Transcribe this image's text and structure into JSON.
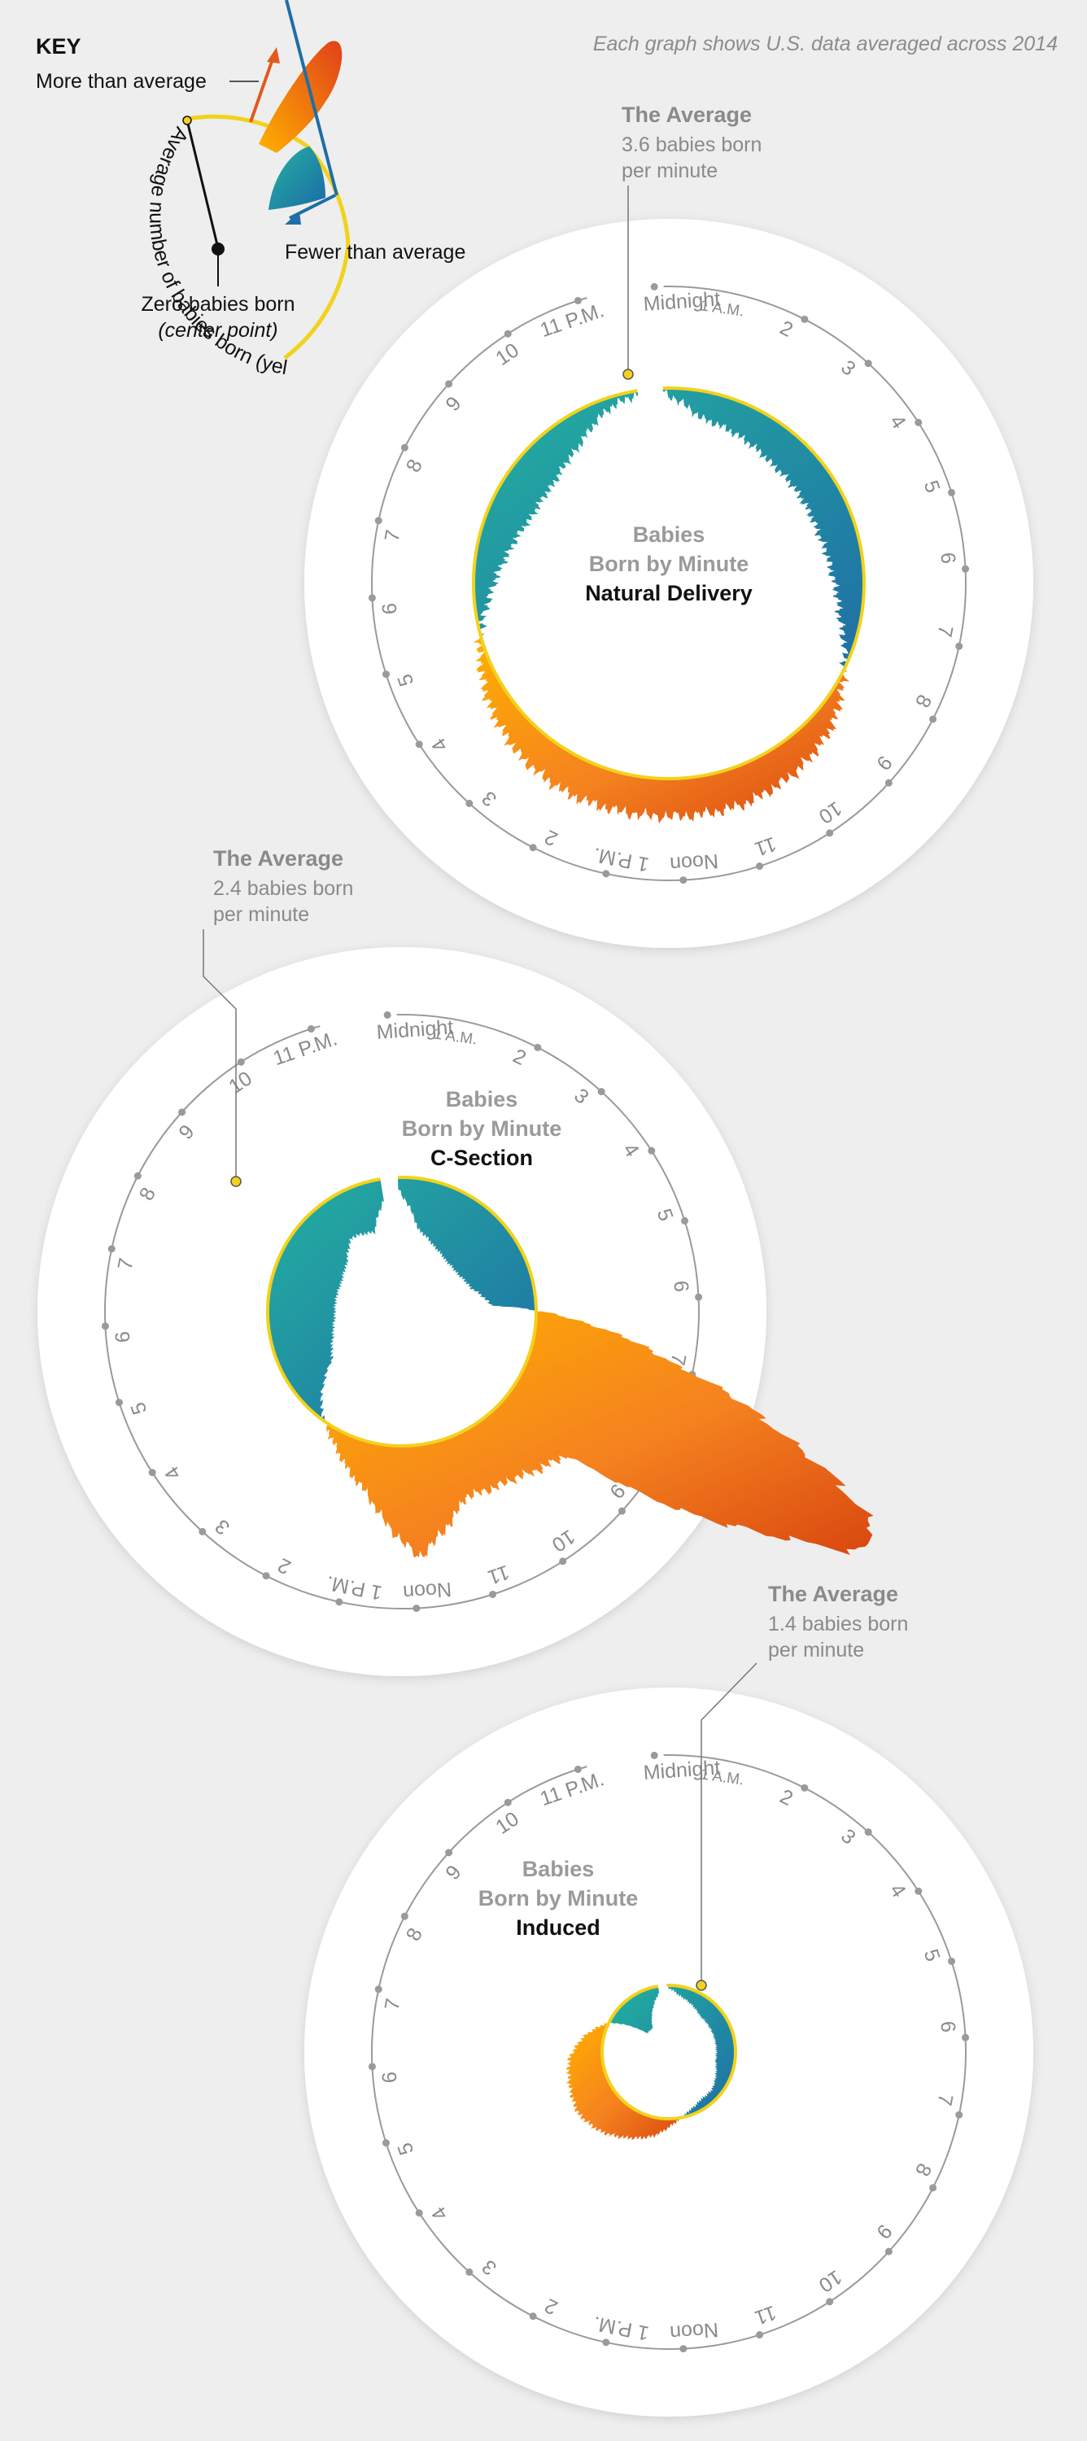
{
  "source_note": "Each graph shows U.S. data averaged across 2014",
  "key": {
    "title": "KEY",
    "more_label": "More than average",
    "fewer_label": "Fewer than average",
    "zero_label_1": "Zero babies born",
    "zero_label_2": "(center point)",
    "arc_label": "Average number of babies born (yellow line)",
    "colors": {
      "more": "#f07b1a",
      "fewer": "#1aa0a0",
      "average_line": "#f2d21b"
    }
  },
  "hour_labels": [
    {
      "hour": 0,
      "text": "Midnight",
      "suffix": "1 A.M."
    },
    {
      "hour": 2,
      "text": "2"
    },
    {
      "hour": 3,
      "text": "3"
    },
    {
      "hour": 4,
      "text": "4"
    },
    {
      "hour": 5,
      "text": "5"
    },
    {
      "hour": 6,
      "text": "6"
    },
    {
      "hour": 7,
      "text": "7"
    },
    {
      "hour": 8,
      "text": "8"
    },
    {
      "hour": 9,
      "text": "9"
    },
    {
      "hour": 10,
      "text": "10"
    },
    {
      "hour": 11,
      "text": "11"
    },
    {
      "hour": 12,
      "text": "Noon"
    },
    {
      "hour": 13,
      "text": "1 P.M."
    },
    {
      "hour": 14,
      "text": "2"
    },
    {
      "hour": 15,
      "text": "3"
    },
    {
      "hour": 16,
      "text": "4"
    },
    {
      "hour": 17,
      "text": "5"
    },
    {
      "hour": 18,
      "text": "6"
    },
    {
      "hour": 19,
      "text": "7"
    },
    {
      "hour": 20,
      "text": "8"
    },
    {
      "hour": 21,
      "text": "9"
    },
    {
      "hour": 22,
      "text": "10"
    },
    {
      "hour": 23,
      "text": "11 P.M."
    }
  ],
  "charts": [
    {
      "center_title_1": "Babies",
      "center_title_2": "Born by Minute",
      "center_title_3": "Natural Delivery",
      "avg_title": "The Average",
      "avg_line_1": "3.6 babies born",
      "avg_line_2": "per minute"
    },
    {
      "center_title_1": "Babies",
      "center_title_2": "Born by Minute",
      "center_title_3": "C-Section",
      "avg_title": "The Average",
      "avg_line_1": "2.4 babies born",
      "avg_line_2": "per minute"
    },
    {
      "center_title_1": "Babies",
      "center_title_2": "Born by Minute",
      "center_title_3": "Induced",
      "avg_title": "The Average",
      "avg_line_1": "1.4 babies born",
      "avg_line_2": "per minute"
    }
  ],
  "chart_data": [
    {
      "type": "radial-area",
      "title": "Babies Born by Minute — Natural Delivery",
      "unit": "babies born per minute",
      "average": 3.6,
      "x_unit": "hour of day",
      "hours": [
        0,
        1,
        2,
        3,
        4,
        5,
        6,
        7,
        8,
        9,
        10,
        11,
        12,
        13,
        14,
        15,
        16,
        17,
        18,
        19,
        20,
        21,
        22,
        23
      ],
      "values": [
        3.6,
        3.1,
        3.0,
        2.9,
        2.9,
        2.9,
        3.0,
        3.2,
        3.6,
        4.0,
        4.2,
        4.3,
        4.3,
        4.3,
        4.3,
        4.2,
        4.0,
        3.7,
        3.3,
        3.0,
        2.8,
        2.8,
        3.0,
        3.4
      ]
    },
    {
      "type": "radial-area",
      "title": "Babies Born by Minute — C-Section",
      "unit": "babies born per minute",
      "average": 2.4,
      "x_unit": "hour of day",
      "hours": [
        0,
        1,
        2,
        3,
        4,
        5,
        6,
        7,
        8,
        9,
        10,
        11,
        12,
        13,
        14,
        15,
        16,
        17,
        18,
        19,
        20,
        21,
        22,
        23
      ],
      "values": [
        2.3,
        1.5,
        1.3,
        1.2,
        1.2,
        1.3,
        1.6,
        5.0,
        9.8,
        3.9,
        3.6,
        3.5,
        4.4,
        3.3,
        2.7,
        2.2,
        1.5,
        1.3,
        1.2,
        1.2,
        1.2,
        1.3,
        1.6,
        1.5
      ]
    },
    {
      "type": "radial-area",
      "title": "Babies Born by Minute — Induced",
      "unit": "babies born per minute",
      "average": 1.4,
      "x_unit": "hour of day",
      "hours": [
        0,
        1,
        2,
        3,
        4,
        5,
        6,
        7,
        8,
        9,
        10,
        11,
        12,
        13,
        14,
        15,
        16,
        17,
        18,
        19,
        20,
        21,
        22,
        23
      ],
      "values": [
        1.4,
        1.2,
        1.1,
        1.0,
        1.0,
        1.0,
        1.0,
        1.0,
        1.1,
        1.2,
        1.2,
        1.3,
        1.5,
        1.8,
        2.0,
        2.2,
        2.3,
        2.2,
        2.1,
        1.8,
        1.4,
        0.6,
        0.6,
        1.0
      ]
    }
  ]
}
